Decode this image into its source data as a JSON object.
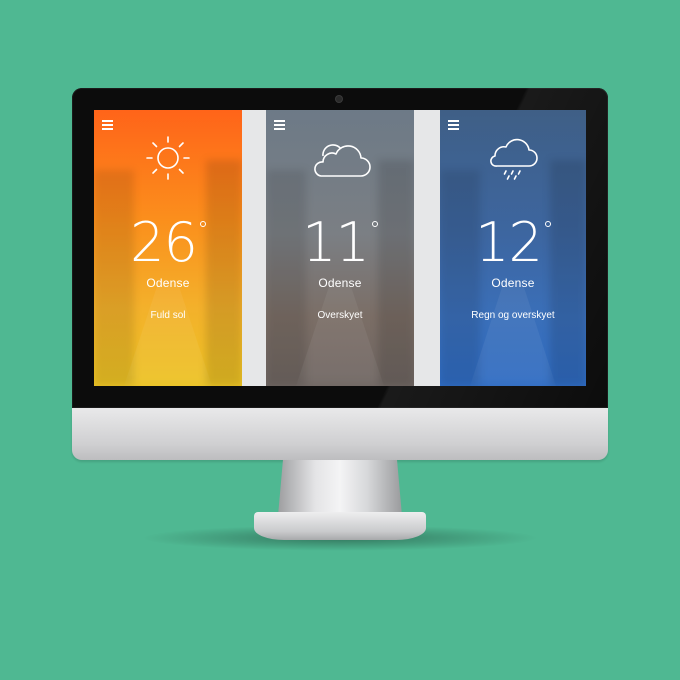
{
  "colors": {
    "background": "#4fb892",
    "sunny_top": "#ff6419",
    "sunny_bottom": "#ecc324",
    "cloudy": "#7b7f84",
    "rain": "#3a6fb9"
  },
  "panels": [
    {
      "icon": "sun-icon",
      "temperature": "26",
      "city": "Odense",
      "condition": "Fuld sol"
    },
    {
      "icon": "cloud-icon",
      "temperature": "11",
      "city": "Odense",
      "condition": "Overskyet"
    },
    {
      "icon": "rain-cloud-icon",
      "temperature": "12",
      "city": "Odense",
      "condition": "Regn og overskyet"
    }
  ]
}
